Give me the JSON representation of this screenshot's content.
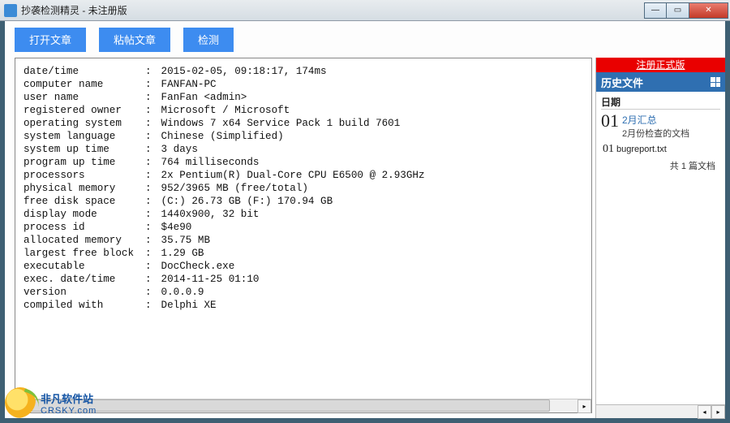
{
  "window": {
    "title": "抄袭检测精灵 - 未注册版"
  },
  "toolbar": {
    "open": "打开文章",
    "paste": "粘帖文章",
    "check": "检测"
  },
  "log": {
    "rows": [
      {
        "k": "date/time",
        "v": "2015-02-05, 09:18:17, 174ms"
      },
      {
        "k": "computer name",
        "v": "FANFAN-PC"
      },
      {
        "k": "user name",
        "v": "FanFan <admin>"
      },
      {
        "k": "registered owner",
        "v": "Microsoft / Microsoft"
      },
      {
        "k": "operating system",
        "v": "Windows 7 x64 Service Pack 1 build 7601"
      },
      {
        "k": "system language",
        "v": "Chinese (Simplified)"
      },
      {
        "k": "system up time",
        "v": "3 days"
      },
      {
        "k": "program up time",
        "v": "764 milliseconds"
      },
      {
        "k": "processors",
        "v": "2x Pentium(R) Dual-Core CPU E6500 @ 2.93GHz"
      },
      {
        "k": "physical memory",
        "v": "952/3965 MB (free/total)"
      },
      {
        "k": "free disk space",
        "v": "(C:) 26.73 GB (F:) 170.94 GB"
      },
      {
        "k": "display mode",
        "v": "1440x900, 32 bit"
      },
      {
        "k": "process id",
        "v": "$4e90"
      },
      {
        "k": "allocated memory",
        "v": "35.75 MB"
      },
      {
        "k": "largest free block",
        "v": "1.29 GB"
      },
      {
        "k": "executable",
        "v": "DocCheck.exe"
      },
      {
        "k": "exec. date/time",
        "v": "2014-11-25 01:10"
      },
      {
        "k": "version",
        "v": "0.0.0.9"
      },
      {
        "k": "compiled with",
        "v": "Delphi XE"
      }
    ]
  },
  "sidebar": {
    "register": "注册正式版",
    "header": "历史文件",
    "date_label": "日期",
    "entry": {
      "num": "01",
      "title": "2月汇总",
      "sub": "2月份检查的文档"
    },
    "file": {
      "num": "01",
      "name": "bugreport.txt"
    },
    "count": "共 1 篇文档"
  },
  "watermark": {
    "cn": "非凡软件站",
    "en": "CRSKY.com"
  }
}
